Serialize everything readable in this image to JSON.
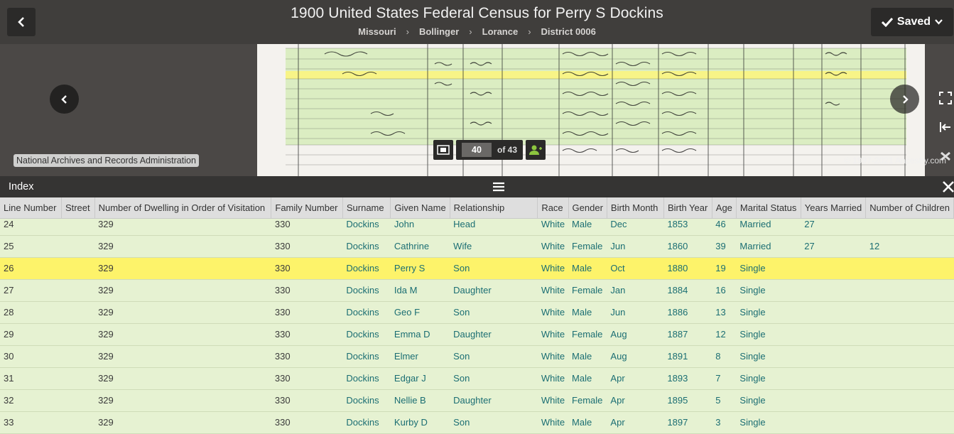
{
  "header": {
    "title": "1900 United States Federal Census for Perry S Dockins",
    "breadcrumbs": [
      "Missouri",
      "Bollinger",
      "Lorance",
      "District 0006"
    ],
    "saved_label": "Saved"
  },
  "viewer": {
    "source_label": "National Archives and Records Administration",
    "copyright": "© 1997-2021 Ancestry.com",
    "page_current": "40",
    "page_total_label": "of 43"
  },
  "index": {
    "title": "Index",
    "columns": [
      "Line Number",
      "Street",
      "Number of Dwelling in Order of Visitation",
      "Family Number",
      "Surname",
      "Given Name",
      "Relationship",
      "Race",
      "Gender",
      "Birth Month",
      "Birth Year",
      "Age",
      "Marital Status",
      "Years Married",
      "Number of Children"
    ],
    "rows": [
      {
        "line": "24",
        "street": "",
        "dwelling": "329",
        "family": "330",
        "surname": "Dockins",
        "given": "John",
        "relationship": "Head",
        "race": "White",
        "gender": "Male",
        "month": "Dec",
        "year": "1853",
        "age": "46",
        "marital": "Married",
        "years_married": "27",
        "children": ""
      },
      {
        "line": "25",
        "street": "",
        "dwelling": "329",
        "family": "330",
        "surname": "Dockins",
        "given": "Cathrine",
        "relationship": "Wife",
        "race": "White",
        "gender": "Female",
        "month": "Jun",
        "year": "1860",
        "age": "39",
        "marital": "Married",
        "years_married": "27",
        "children": "12"
      },
      {
        "line": "26",
        "street": "",
        "dwelling": "329",
        "family": "330",
        "surname": "Dockins",
        "given": "Perry S",
        "relationship": "Son",
        "race": "White",
        "gender": "Male",
        "month": "Oct",
        "year": "1880",
        "age": "19",
        "marital": "Single",
        "years_married": "",
        "children": "",
        "selected": true
      },
      {
        "line": "27",
        "street": "",
        "dwelling": "329",
        "family": "330",
        "surname": "Dockins",
        "given": "Ida M",
        "relationship": "Daughter",
        "race": "White",
        "gender": "Female",
        "month": "Jan",
        "year": "1884",
        "age": "16",
        "marital": "Single",
        "years_married": "",
        "children": ""
      },
      {
        "line": "28",
        "street": "",
        "dwelling": "329",
        "family": "330",
        "surname": "Dockins",
        "given": "Geo F",
        "relationship": "Son",
        "race": "White",
        "gender": "Male",
        "month": "Jun",
        "year": "1886",
        "age": "13",
        "marital": "Single",
        "years_married": "",
        "children": ""
      },
      {
        "line": "29",
        "street": "",
        "dwelling": "329",
        "family": "330",
        "surname": "Dockins",
        "given": "Emma D",
        "relationship": "Daughter",
        "race": "White",
        "gender": "Female",
        "month": "Aug",
        "year": "1887",
        "age": "12",
        "marital": "Single",
        "years_married": "",
        "children": ""
      },
      {
        "line": "30",
        "street": "",
        "dwelling": "329",
        "family": "330",
        "surname": "Dockins",
        "given": "Elmer",
        "relationship": "Son",
        "race": "White",
        "gender": "Male",
        "month": "Aug",
        "year": "1891",
        "age": "8",
        "marital": "Single",
        "years_married": "",
        "children": ""
      },
      {
        "line": "31",
        "street": "",
        "dwelling": "329",
        "family": "330",
        "surname": "Dockins",
        "given": "Edgar J",
        "relationship": "Son",
        "race": "White",
        "gender": "Male",
        "month": "Apr",
        "year": "1893",
        "age": "7",
        "marital": "Single",
        "years_married": "",
        "children": ""
      },
      {
        "line": "32",
        "street": "",
        "dwelling": "329",
        "family": "330",
        "surname": "Dockins",
        "given": "Nellie B",
        "relationship": "Daughter",
        "race": "White",
        "gender": "Female",
        "month": "Apr",
        "year": "1895",
        "age": "5",
        "marital": "Single",
        "years_married": "",
        "children": ""
      },
      {
        "line": "33",
        "street": "",
        "dwelling": "329",
        "family": "330",
        "surname": "Dockins",
        "given": "Kurby D",
        "relationship": "Son",
        "race": "White",
        "gender": "Male",
        "month": "Apr",
        "year": "1897",
        "age": "3",
        "marital": "Single",
        "years_married": "",
        "children": ""
      }
    ]
  },
  "icons": {
    "back": "chevron-left-icon",
    "saved": "checkmark-icon",
    "saved_dropdown": "chevron-down-icon",
    "prev": "chevron-left-icon",
    "next": "chevron-right-icon",
    "fullscreen": "fullscreen-icon",
    "exit_panel": "arrow-to-left-icon",
    "tools": "tools-icon",
    "filmstrip": "filmstrip-icon",
    "person": "person-icon",
    "menu": "hamburger-icon",
    "close": "close-icon"
  },
  "colors": {
    "highlight_row": "#fdf36a",
    "row_background": "#e6f2d2",
    "link_teal": "#1b6e73",
    "toolbar_dark": "#2b2a29"
  }
}
